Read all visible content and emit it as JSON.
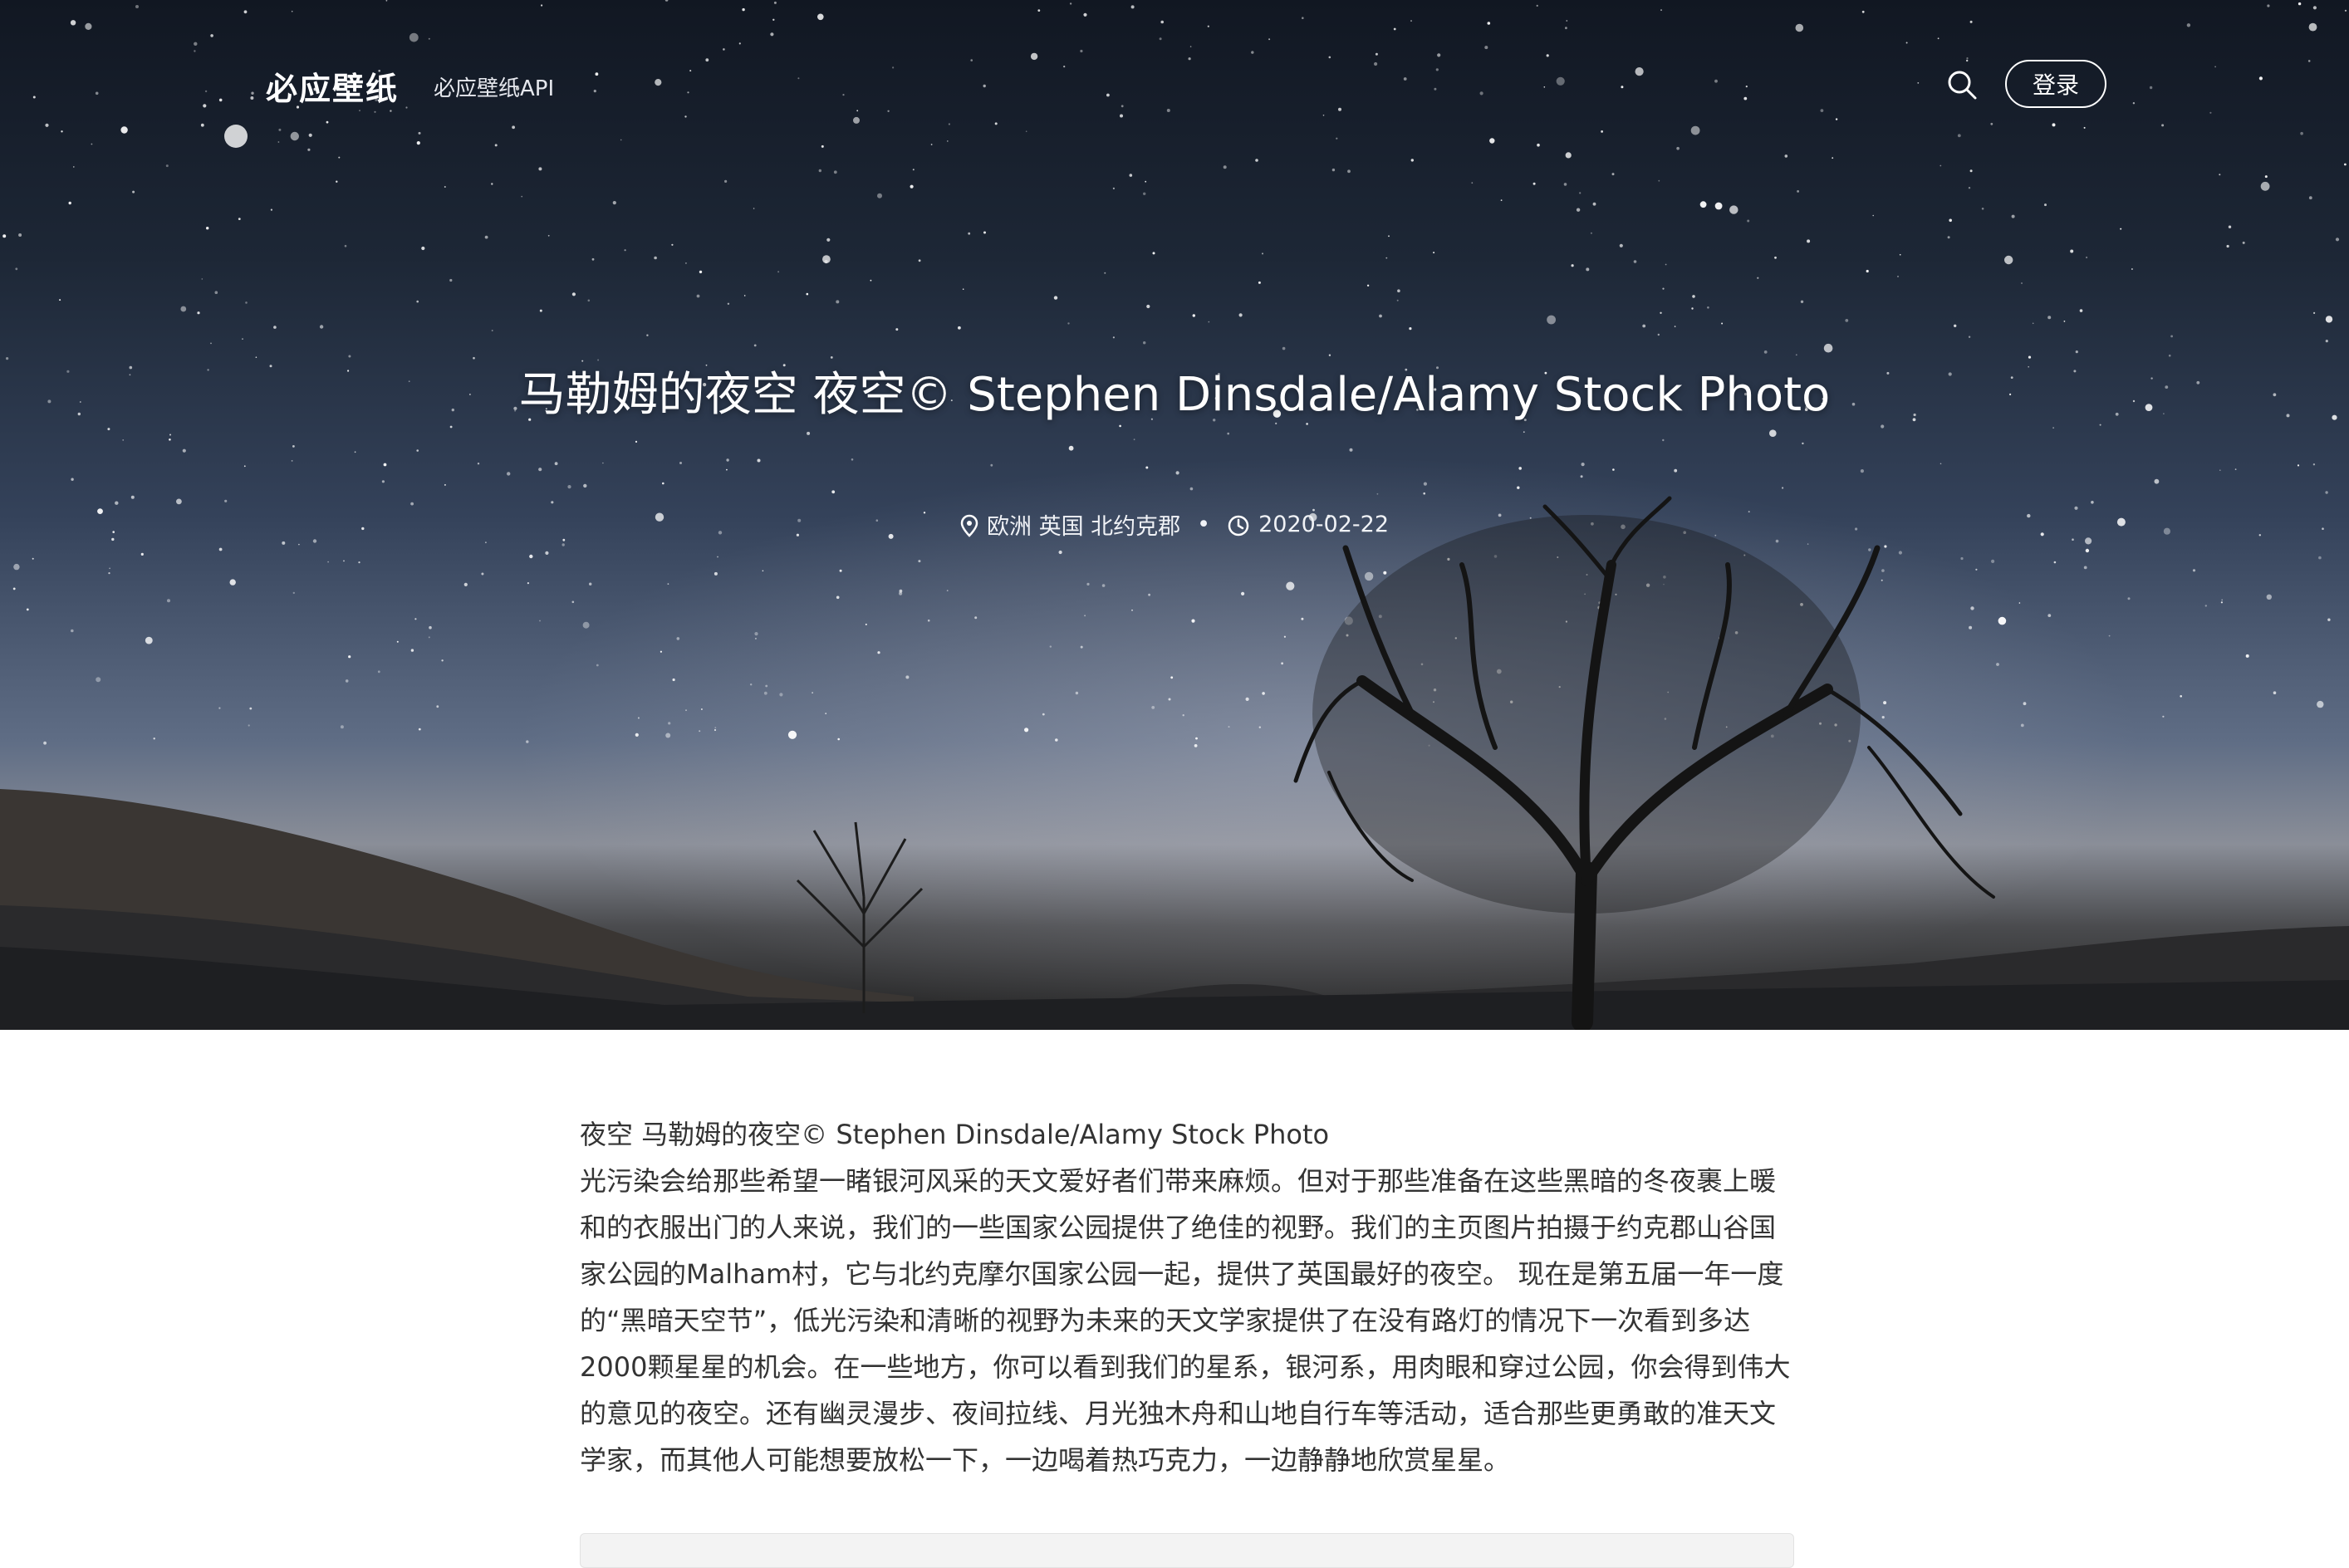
{
  "nav": {
    "brand": "必应壁纸",
    "api_link": "必应壁纸API",
    "search_icon": "search-icon",
    "login_label": "登录"
  },
  "hero": {
    "title": "马勒姆的夜空 夜空© Stephen Dinsdale/Alamy Stock Photo",
    "location_icon": "map-pin-icon",
    "location": "欧洲 英国 北约克郡",
    "separator": "•",
    "clock_icon": "clock-icon",
    "date": "2020-02-22"
  },
  "article": {
    "caption": "夜空 马勒姆的夜空© Stephen Dinsdale/Alamy Stock Photo",
    "body": "光污染会给那些希望一睹银河风采的天文爱好者们带来麻烦。但对于那些准备在这些黑暗的冬夜裹上暖和的衣服出门的人来说，我们的一些国家公园提供了绝佳的视野。我们的主页图片拍摄于约克郡山谷国家公园的Malham村，它与北约克摩尔国家公园一起，提供了英国最好的夜空。 现在是第五届一年一度的“黑暗天空节”，低光污染和清晰的视野为未来的天文学家提供了在没有路灯的情况下一次看到多达2000颗星星的机会。在一些地方，你可以看到我们的星系，银河系，用肉眼和穿过公园，你会得到伟大的意见的夜空。还有幽灵漫步、夜间拉线、月光独木舟和山地自行车等活动，适合那些更勇敢的准天文学家，而其他人可能想要放松一下，一边喝着热巧克力，一边静静地欣赏星星。"
  },
  "colors": {
    "sky_top": "#111722",
    "sky_mid": "#34425a",
    "text_dark": "#333333",
    "white": "#ffffff"
  }
}
